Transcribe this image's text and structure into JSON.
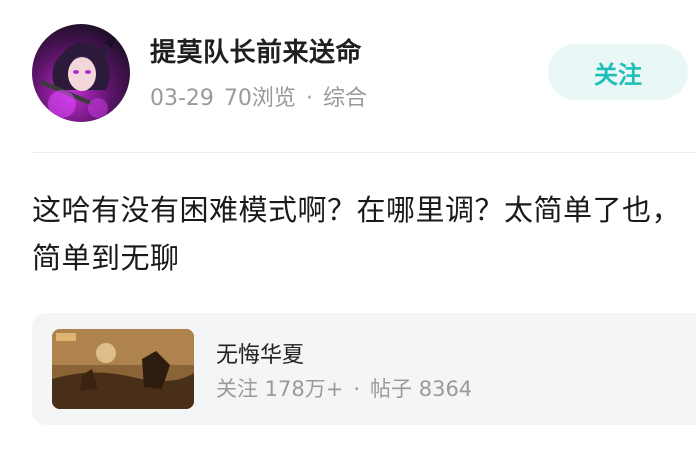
{
  "author": {
    "name": "提莫队长前来送命",
    "date": "03-29",
    "views": "70浏览",
    "separator": "·",
    "category": "综合",
    "avatar_icon": "anime-character-avatar"
  },
  "follow_button": {
    "label": "关注",
    "bg_color": "#e9f7f7",
    "text_color": "#1dbfb8"
  },
  "post": {
    "text": "这哈有没有困难模式啊？在哪里调？太简单了也，简单到无聊"
  },
  "game_card": {
    "name": "无悔华夏",
    "followers": "关注 178万+",
    "separator": "·",
    "posts": "帖子 8364",
    "thumb_icon": "game-cover-thumbnail"
  }
}
